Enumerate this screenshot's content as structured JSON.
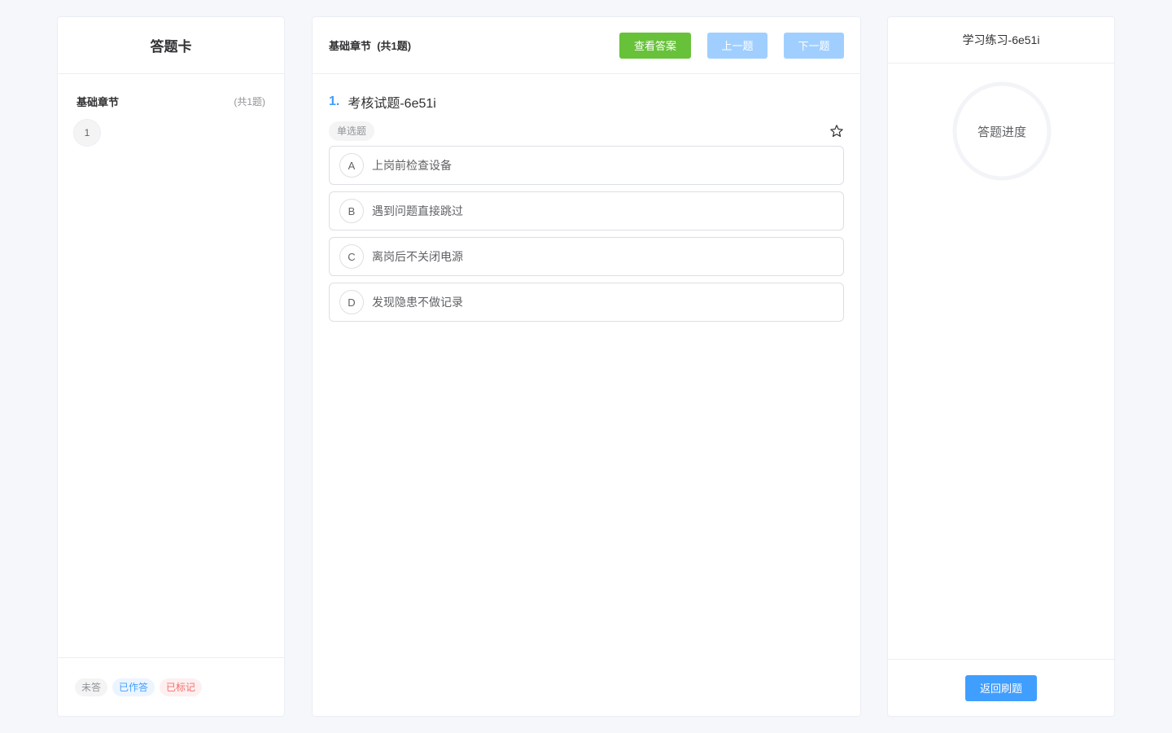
{
  "answer_card": {
    "title": "答题卡",
    "chapter": {
      "name": "基础章节",
      "count": "(共1题)"
    },
    "question_numbers": [
      "1"
    ],
    "legend": {
      "unanswered": "未答",
      "answered": "已作答",
      "marked": "已标记"
    }
  },
  "question_panel": {
    "header_title": "基础章节  (共1题)",
    "buttons": {
      "view_answer": "查看答案",
      "prev": "上一题",
      "next": "下一题"
    },
    "question": {
      "index": "1.",
      "title": "考核试题-6e51i",
      "type": "单选题",
      "star_icon": "star-icon",
      "options": [
        {
          "letter": "A",
          "text": "上岗前检查设备"
        },
        {
          "letter": "B",
          "text": "遇到问题直接跳过"
        },
        {
          "letter": "C",
          "text": "离岗后不关闭电源"
        },
        {
          "letter": "D",
          "text": "发现隐患不做记录"
        }
      ]
    }
  },
  "progress_panel": {
    "title": "学习练习-6e51i",
    "progress_label": "答题进度",
    "progress_fraction": 0,
    "back_button": "返回刷题"
  },
  "colors": {
    "primary": "#409eff",
    "success": "#67c23a",
    "disabled_primary": "#a0cfff",
    "danger": "#f56c6c"
  }
}
